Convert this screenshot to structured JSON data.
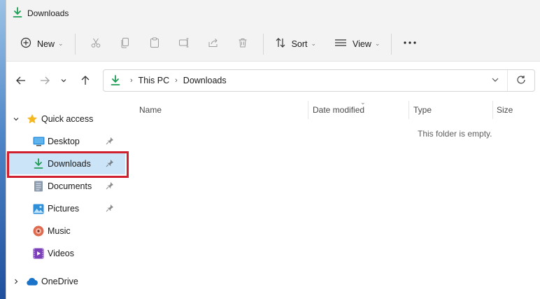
{
  "window": {
    "title": "Downloads"
  },
  "toolbar": {
    "new_label": "New",
    "sort_label": "Sort",
    "view_label": "View",
    "icons": [
      "new-icon",
      "cut-icon",
      "copy-icon",
      "paste-icon",
      "rename-icon",
      "share-icon",
      "delete-icon",
      "sort-icon",
      "view-icon",
      "more-icon"
    ]
  },
  "address": {
    "crumbs": [
      "This PC",
      "Downloads"
    ]
  },
  "nav_pane": {
    "quick_access_label": "Quick access",
    "items": [
      {
        "label": "Desktop",
        "icon": "desktop-icon",
        "pinned": true
      },
      {
        "label": "Downloads",
        "icon": "downloads-icon",
        "pinned": true,
        "selected": true
      },
      {
        "label": "Documents",
        "icon": "documents-icon",
        "pinned": true
      },
      {
        "label": "Pictures",
        "icon": "pictures-icon",
        "pinned": true
      },
      {
        "label": "Music",
        "icon": "music-icon",
        "pinned": false
      },
      {
        "label": "Videos",
        "icon": "videos-icon",
        "pinned": false
      }
    ],
    "onedrive_label": "OneDrive"
  },
  "content": {
    "columns": [
      "Name",
      "Date modified",
      "Type",
      "Size"
    ],
    "empty_message": "This folder is empty."
  },
  "colors": {
    "accent_green": "#1f9d55",
    "selection_bg": "#cce4f7",
    "highlight_red": "#d0202e",
    "folder_blue": "#2f8fd8"
  }
}
